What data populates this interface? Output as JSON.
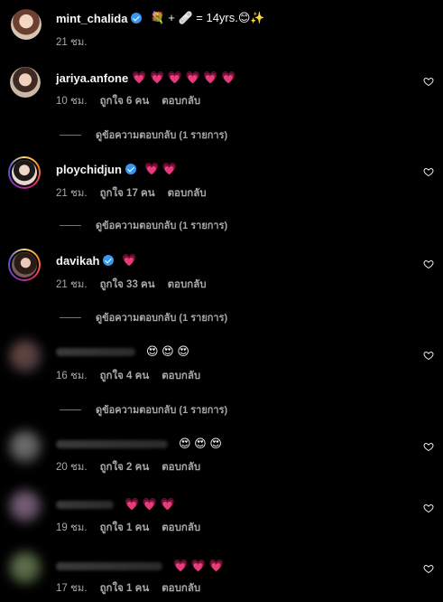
{
  "caption": {
    "username": "mint_chalida",
    "text": "💐 + 🩹 = 14yrs.😊✨",
    "time": "21 ชม."
  },
  "comments": [
    {
      "username": "jariya.anfone",
      "verified": false,
      "text": "💗 💗 💗 💗 💗 💗",
      "time": "10 ชม.",
      "likes": "ถูกใจ 6 คน",
      "reply_label": "ตอบกลับ",
      "view_replies": "ดูข้อความตอบกลับ (1 รายการ)"
    },
    {
      "username": "ploychidjun",
      "verified": true,
      "text": "💗 💗",
      "time": "21 ชม.",
      "likes": "ถูกใจ 17 คน",
      "reply_label": "ตอบกลับ",
      "view_replies": "ดูข้อความตอบกลับ (1 รายการ)"
    },
    {
      "username": "davikah",
      "verified": true,
      "text": "💗",
      "time": "21 ชม.",
      "likes": "ถูกใจ 33 คน",
      "reply_label": "ตอบกลับ",
      "view_replies": "ดูข้อความตอบกลับ (1 รายการ)"
    },
    {
      "username": "",
      "verified": false,
      "text": "😍 😍 😍",
      "time": "16 ชม.",
      "likes": "ถูกใจ 4 คน",
      "reply_label": "ตอบกลับ",
      "view_replies": "ดูข้อความตอบกลับ (1 รายการ)"
    },
    {
      "username": "",
      "verified": false,
      "text": "😍 😍 😍",
      "time": "20 ชม.",
      "likes": "ถูกใจ 2 คน",
      "reply_label": "ตอบกลับ"
    },
    {
      "username": "",
      "verified": false,
      "text": "💗 💗 💗",
      "time": "19 ชม.",
      "likes": "ถูกใจ 1 คน",
      "reply_label": "ตอบกลับ"
    },
    {
      "username": "",
      "verified": false,
      "text": "💗 💗 💗",
      "time": "17 ชม.",
      "likes": "ถูกใจ 1 คน",
      "reply_label": "ตอบกลับ"
    }
  ],
  "icons": {
    "like": "heart-outline-icon",
    "verified": "verified-badge-icon"
  },
  "colors": {
    "background": "#000000",
    "text": "#f5f5f5",
    "secondary": "#a8a8a8",
    "verified": "#3897f0"
  }
}
